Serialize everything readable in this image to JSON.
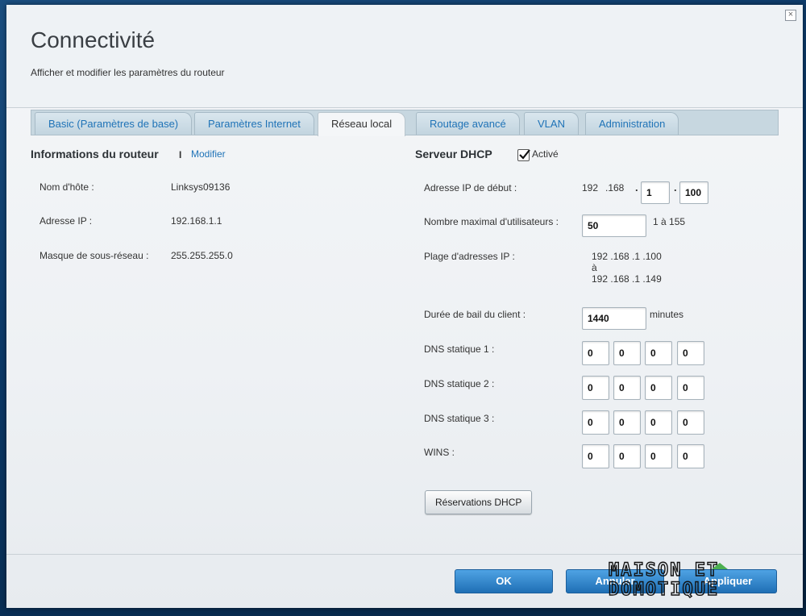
{
  "dialog": {
    "title": "Connectivité",
    "subtitle": "Afficher et modifier les paramètres du routeur"
  },
  "tabs": [
    {
      "label": "Basic (Paramètres de base)",
      "active": false
    },
    {
      "label": "Paramètres Internet",
      "active": false
    },
    {
      "label": "Réseau local",
      "active": true
    },
    {
      "label": "Routage avancé",
      "active": false
    },
    {
      "label": "VLAN",
      "active": false
    },
    {
      "label": "Administration",
      "active": false
    }
  ],
  "router_info": {
    "title": "Informations du routeur",
    "separator": "I",
    "edit_link": "Modifier",
    "hostname_label": "Nom d'hôte :",
    "hostname_value": "Linksys09136",
    "ip_label": "Adresse IP :",
    "ip_value": "192.168.1.1",
    "mask_label": "Masque de sous-réseau :",
    "mask_value": "255.255.255.0"
  },
  "dhcp": {
    "title": "Serveur DHCP",
    "enabled_label": "Activé",
    "enabled": true,
    "start_ip_label": "Adresse IP de début :",
    "start_ip_prefix_1": "192",
    "start_ip_prefix_2": ".168",
    "start_ip_octet3": "1",
    "start_ip_octet4": "100",
    "max_users_label": "Nombre maximal d'utilisateurs :",
    "max_users_value": "50",
    "max_users_range": "1 à 155",
    "range_label": "Plage d'adresses IP :",
    "range_start": "192 .168 .1 .100",
    "range_to": "à",
    "range_end": "192 .168 .1 .149",
    "lease_label": "Durée de bail du client :",
    "lease_value": "1440",
    "lease_unit": "minutes",
    "dns1_label": "DNS statique 1 :",
    "dns1": [
      "0",
      "0",
      "0",
      "0"
    ],
    "dns2_label": "DNS statique 2 :",
    "dns2": [
      "0",
      "0",
      "0",
      "0"
    ],
    "dns3_label": "DNS statique 3 :",
    "dns3": [
      "0",
      "0",
      "0",
      "0"
    ],
    "wins_label": "WINS :",
    "wins": [
      "0",
      "0",
      "0",
      "0"
    ],
    "reservations_button": "Réservations DHCP"
  },
  "footer": {
    "ok_label": "OK",
    "cancel_label": "Annuler",
    "apply_label": "Appliquer"
  },
  "watermark": {
    "line1": "MAISON ET",
    "line2": "DOMOTIQUE"
  },
  "colors": {
    "accent": "#1f73b7",
    "button_blue": "#2a7cc4"
  }
}
